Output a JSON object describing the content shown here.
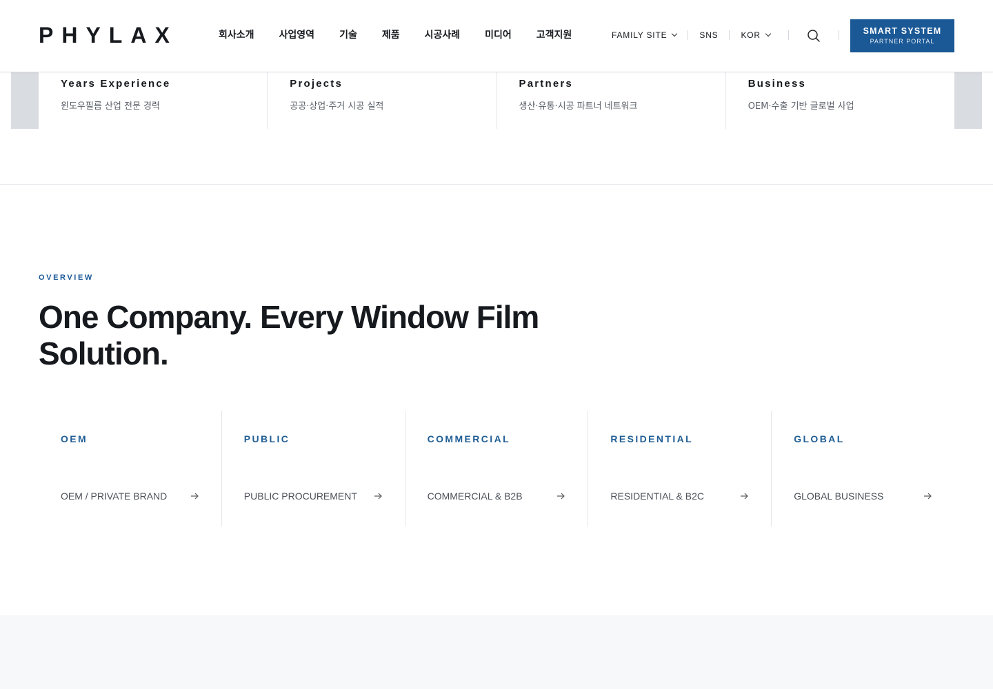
{
  "header": {
    "logo": "PHYLAX",
    "nav": [
      "회사소개",
      "사업영역",
      "기술",
      "제품",
      "시공사례",
      "미디어",
      "고객지원"
    ],
    "utils": {
      "family_site": "FAMILY SITE",
      "sns": "SNS",
      "lang": "KOR"
    },
    "cta": {
      "main": "SMART SYSTEM",
      "sub": "PARTNER PORTAL"
    }
  },
  "stats": [
    {
      "title": "Years Experience",
      "desc": "윈도우필름 산업 전문 경력"
    },
    {
      "title": "Projects",
      "desc": "공공·상업·주거 시공 실적"
    },
    {
      "title": "Partners",
      "desc": "생산·유통·시공 파트너 네트워크"
    },
    {
      "title": "Business",
      "desc": "OEM·수출 기반 글로벌 사업"
    }
  ],
  "overview": {
    "eyebrow": "OVERVIEW",
    "headline_line1": "One Company. Every Window Film",
    "headline_line2": "Solution."
  },
  "cards": [
    {
      "tag": "OEM",
      "label": "OEM / PRIVATE BRAND"
    },
    {
      "tag": "PUBLIC",
      "label": "PUBLIC PROCUREMENT"
    },
    {
      "tag": "COMMERCIAL",
      "label": "COMMERCIAL & B2B"
    },
    {
      "tag": "RESIDENTIAL",
      "label": "RESIDENTIAL & B2C"
    },
    {
      "tag": "GLOBAL",
      "label": "GLOBAL BUSINESS"
    }
  ],
  "colors": {
    "accent": "#1a5896",
    "text": "#16191d",
    "muted": "#5a6068",
    "band": "#f7f8fa"
  },
  "icons": [
    "search-icon",
    "chevron-down-icon",
    "arrow-right-icon"
  ]
}
